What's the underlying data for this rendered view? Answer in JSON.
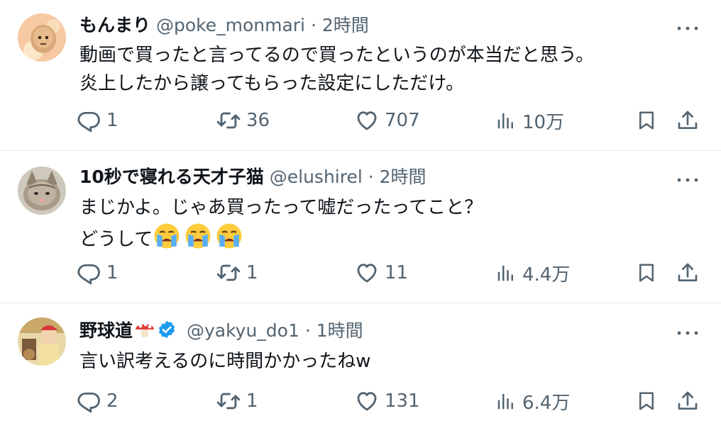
{
  "tweets": [
    {
      "name": "もんまり",
      "handle": "@poke_monmari",
      "dot": "·",
      "time": "2時間",
      "lines": [
        "動画で買ったと言ってるので買ったというのが本当だと思う。",
        "炎上したから譲ってもらった設定にしただけ。"
      ],
      "replies": "1",
      "retweets": "36",
      "likes": "707",
      "views": "10万"
    },
    {
      "name": "10秒で寝れる天才子猫",
      "handle": "@elushirel",
      "dot": "·",
      "time": "2時間",
      "lines": [
        "まじかよ。じゃあ買ったって嘘だったってこと？",
        "どうして"
      ],
      "replies": "1",
      "retweets": "1",
      "likes": "11",
      "views": "4.4万"
    },
    {
      "name": "野球道",
      "handle": "@yakyu_do1",
      "dot": "·",
      "time": "1時間",
      "lines": [
        "言い訳考えるのに時間かかったねw"
      ],
      "replies": "2",
      "retweets": "1",
      "likes": "131",
      "views": "6.4万"
    }
  ],
  "icons": [
    "reply-icon",
    "retweet-icon",
    "like-icon",
    "views-icon",
    "bookmark-icon",
    "share-icon",
    "more-icon",
    "verified-icon",
    "mushroom-emoji",
    "crying-face-emoji"
  ],
  "colors": {
    "text": "#0f1419",
    "secondary": "#536471",
    "verified": "#1d9bf0",
    "divider": "#e7eaec"
  }
}
